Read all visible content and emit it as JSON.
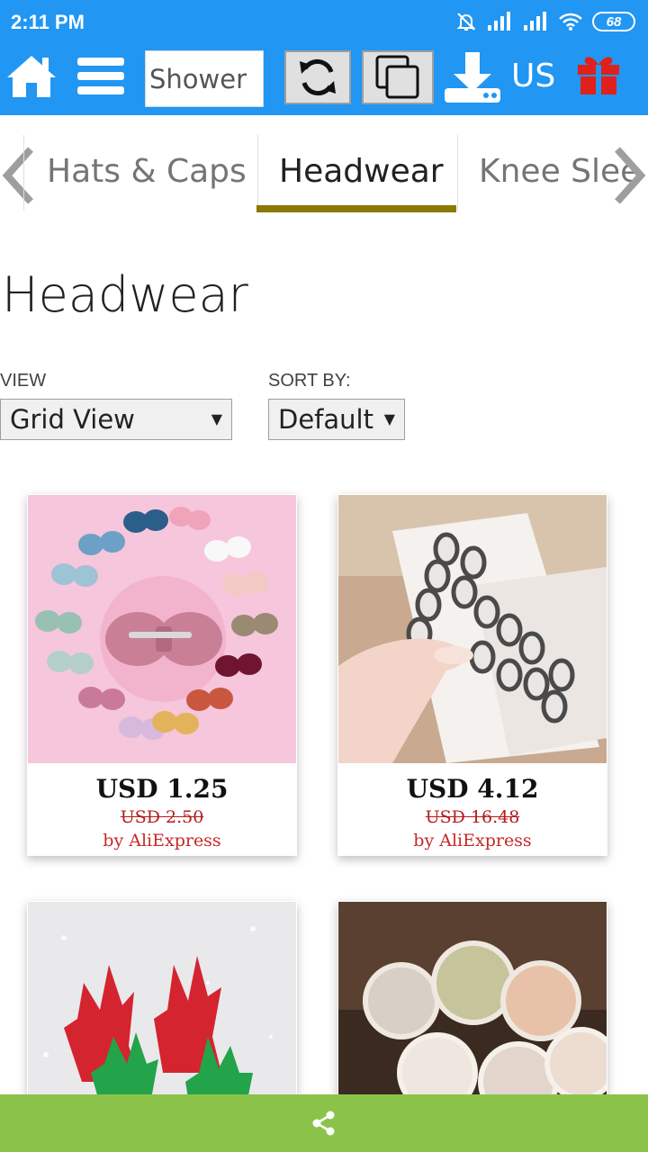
{
  "status_bar": {
    "time": "2:11 PM",
    "battery": "68"
  },
  "toolbar": {
    "search_value": "Shower",
    "region": "US"
  },
  "category_tabs": [
    {
      "label": "Hats & Caps",
      "active": false
    },
    {
      "label": "Headwear",
      "active": true
    },
    {
      "label": "Knee Slee",
      "active": false
    }
  ],
  "page": {
    "title": "Headwear",
    "view_label": "VIEW",
    "view_value": "Grid View",
    "sort_label": "SORT BY:",
    "sort_value": "Default"
  },
  "products": [
    {
      "price": "USD 1.25",
      "old_price": "USD 2.50",
      "seller": "by AliExpress"
    },
    {
      "price": "USD 4.12",
      "old_price": "USD 16.48",
      "seller": "by AliExpress"
    },
    {
      "price": "",
      "old_price": "",
      "seller": ""
    },
    {
      "price": "",
      "old_price": "",
      "seller": ""
    }
  ],
  "colors": {
    "toolbar_bg": "#2196f3",
    "bottom_bar_bg": "#8bc34a",
    "tab_underline": "#8a7a00",
    "seller_text": "#c62828"
  },
  "icons": {
    "home": "home-icon",
    "menu": "menu-icon",
    "refresh": "refresh-icon",
    "copy": "copy-icon",
    "download": "download-icon",
    "gift": "gift-icon",
    "share": "share-icon"
  }
}
